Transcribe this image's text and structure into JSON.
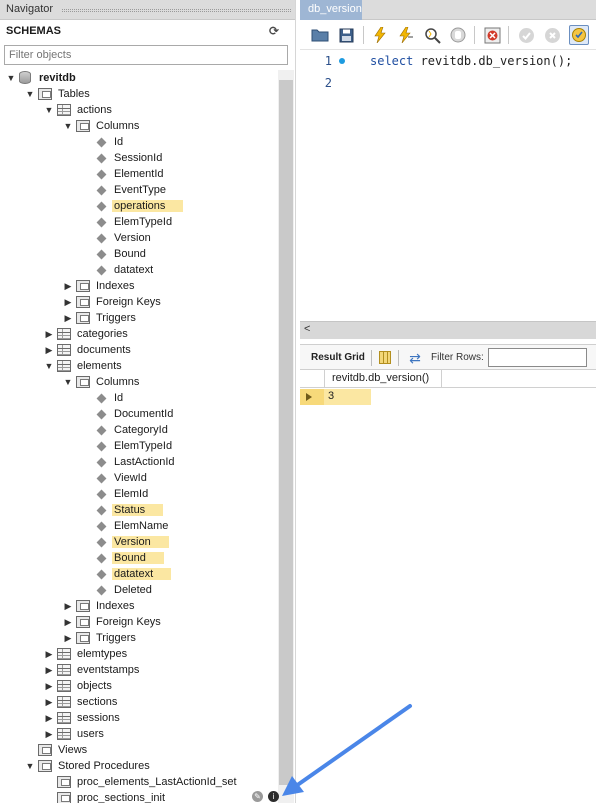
{
  "navigator": {
    "title": "Navigator",
    "schemas_label": "SCHEMAS",
    "filter_placeholder": "Filter objects",
    "tree": [
      {
        "label": "revitdb",
        "indent": 0,
        "toggle": "down",
        "icon": "db",
        "bold": true
      },
      {
        "label": "Tables",
        "indent": 1,
        "toggle": "down",
        "icon": "folder"
      },
      {
        "label": "actions",
        "indent": 2,
        "toggle": "down",
        "icon": "table"
      },
      {
        "label": "Columns",
        "indent": 3,
        "toggle": "down",
        "icon": "folder"
      },
      {
        "label": "Id",
        "indent": 4,
        "icon": "diamond"
      },
      {
        "label": "SessionId",
        "indent": 4,
        "icon": "diamond"
      },
      {
        "label": "ElementId",
        "indent": 4,
        "icon": "diamond"
      },
      {
        "label": "EventType",
        "indent": 4,
        "icon": "diamond"
      },
      {
        "label": "operations",
        "indent": 4,
        "icon": "diamond",
        "highlight": true
      },
      {
        "label": "ElemTypeId",
        "indent": 4,
        "icon": "diamond"
      },
      {
        "label": "Version",
        "indent": 4,
        "icon": "diamond"
      },
      {
        "label": "Bound",
        "indent": 4,
        "icon": "diamond"
      },
      {
        "label": "datatext",
        "indent": 4,
        "icon": "diamond"
      },
      {
        "label": "Indexes",
        "indent": 3,
        "toggle": "right",
        "icon": "folder"
      },
      {
        "label": "Foreign Keys",
        "indent": 3,
        "toggle": "right",
        "icon": "folder"
      },
      {
        "label": "Triggers",
        "indent": 3,
        "toggle": "right",
        "icon": "folder"
      },
      {
        "label": "categories",
        "indent": 2,
        "toggle": "right",
        "icon": "table"
      },
      {
        "label": "documents",
        "indent": 2,
        "toggle": "right",
        "icon": "table"
      },
      {
        "label": "elements",
        "indent": 2,
        "toggle": "down",
        "icon": "table"
      },
      {
        "label": "Columns",
        "indent": 3,
        "toggle": "down",
        "icon": "folder"
      },
      {
        "label": "Id",
        "indent": 4,
        "icon": "diamond"
      },
      {
        "label": "DocumentId",
        "indent": 4,
        "icon": "diamond"
      },
      {
        "label": "CategoryId",
        "indent": 4,
        "icon": "diamond"
      },
      {
        "label": "ElemTypeId",
        "indent": 4,
        "icon": "diamond"
      },
      {
        "label": "LastActionId",
        "indent": 4,
        "icon": "diamond"
      },
      {
        "label": "ViewId",
        "indent": 4,
        "icon": "diamond"
      },
      {
        "label": "ElemId",
        "indent": 4,
        "icon": "diamond"
      },
      {
        "label": "Status",
        "indent": 4,
        "icon": "diamond",
        "highlight": true
      },
      {
        "label": "ElemName",
        "indent": 4,
        "icon": "diamond"
      },
      {
        "label": "Version",
        "indent": 4,
        "icon": "diamond",
        "highlight": true
      },
      {
        "label": "Bound",
        "indent": 4,
        "icon": "diamond",
        "highlight": true
      },
      {
        "label": "datatext",
        "indent": 4,
        "icon": "diamond",
        "highlight": true
      },
      {
        "label": "Deleted",
        "indent": 4,
        "icon": "diamond"
      },
      {
        "label": "Indexes",
        "indent": 3,
        "toggle": "right",
        "icon": "folder"
      },
      {
        "label": "Foreign Keys",
        "indent": 3,
        "toggle": "right",
        "icon": "folder"
      },
      {
        "label": "Triggers",
        "indent": 3,
        "toggle": "right",
        "icon": "folder"
      },
      {
        "label": "elemtypes",
        "indent": 2,
        "toggle": "right",
        "icon": "table"
      },
      {
        "label": "eventstamps",
        "indent": 2,
        "toggle": "right",
        "icon": "table"
      },
      {
        "label": "objects",
        "indent": 2,
        "toggle": "right",
        "icon": "table"
      },
      {
        "label": "sections",
        "indent": 2,
        "toggle": "right",
        "icon": "table"
      },
      {
        "label": "sessions",
        "indent": 2,
        "toggle": "right",
        "icon": "table"
      },
      {
        "label": "users",
        "indent": 2,
        "toggle": "right",
        "icon": "table"
      },
      {
        "label": "Views",
        "indent": 1,
        "icon": "folder"
      },
      {
        "label": "Stored Procedures",
        "indent": 1,
        "toggle": "down",
        "icon": "folder"
      },
      {
        "label": "proc_elements_LastActionId_set",
        "indent": 2,
        "icon": "folder"
      },
      {
        "label": "proc_sections_init",
        "indent": 2,
        "icon": "folder"
      }
    ]
  },
  "editor": {
    "tab_label": "db_version",
    "toolbar_icons": [
      "open-folder-icon",
      "save-icon",
      "execute-icon",
      "execute-current-icon",
      "explain-icon",
      "stop-icon",
      "toggle-error-icon",
      "commit-icon",
      "rollback-icon",
      "autocommit-icon"
    ],
    "lines": [
      {
        "number": "1",
        "keyword": "select",
        "rest": " revitdb.db_version();"
      },
      {
        "number": "2",
        "keyword": "",
        "rest": ""
      }
    ]
  },
  "results": {
    "result_grid_label": "Result Grid",
    "filter_rows_label": "Filter Rows:",
    "filter_rows_value": "",
    "column_header": "revitdb.db_version()",
    "rows": [
      "3"
    ]
  }
}
